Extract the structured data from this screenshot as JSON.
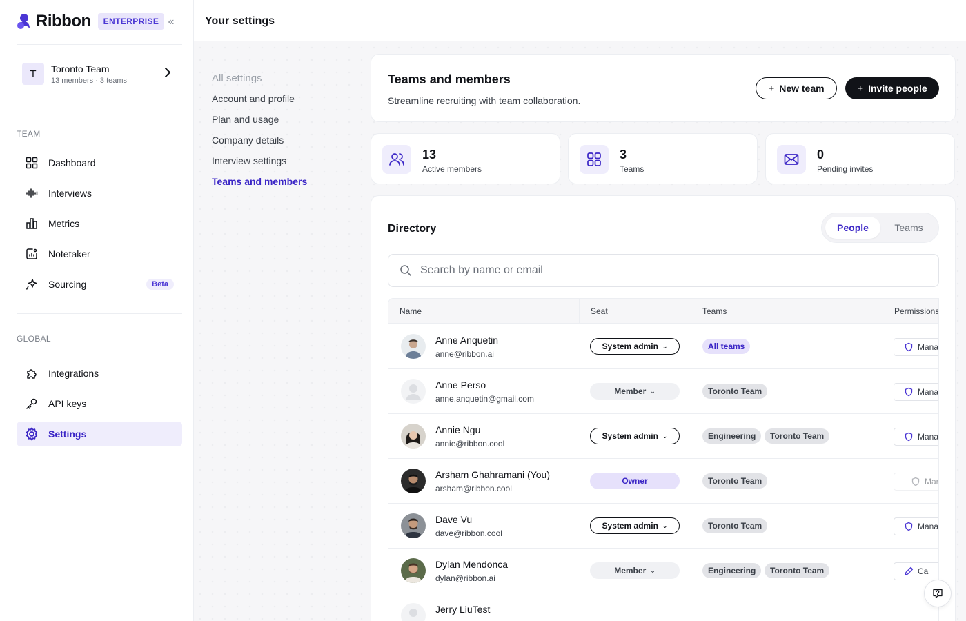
{
  "brand": {
    "name": "Ribbon",
    "badge": "ENTERPRISE",
    "accent": "#3b26c6"
  },
  "team_switcher": {
    "avatar_letter": "T",
    "name": "Toronto Team",
    "meta": "13 members · 3 teams"
  },
  "sidebar": {
    "team_section": "TEAM",
    "team_items": [
      {
        "label": "Dashboard",
        "icon": "grid-icon"
      },
      {
        "label": "Interviews",
        "icon": "waveform-icon"
      },
      {
        "label": "Metrics",
        "icon": "bar-chart-icon"
      },
      {
        "label": "Notetaker",
        "icon": "notetaker-icon"
      },
      {
        "label": "Sourcing",
        "icon": "sparkle-icon",
        "badge": "Beta"
      }
    ],
    "global_section": "GLOBAL",
    "global_items": [
      {
        "label": "Integrations",
        "icon": "puzzle-icon"
      },
      {
        "label": "API keys",
        "icon": "key-icon"
      },
      {
        "label": "Settings",
        "icon": "gear-icon",
        "active": true
      }
    ]
  },
  "topbar": {
    "title": "Your settings"
  },
  "settings_nav": {
    "heading": "All settings",
    "links": [
      "Account and profile",
      "Plan and usage",
      "Company details",
      "Interview settings",
      "Teams and members"
    ],
    "active": "Teams and members"
  },
  "header": {
    "title": "Teams and members",
    "subtitle": "Streamline recruiting with team collaboration.",
    "new_team": "New team",
    "invite": "Invite people"
  },
  "stats": [
    {
      "value": "13",
      "label": "Active members",
      "icon": "users-icon"
    },
    {
      "value": "3",
      "label": "Teams",
      "icon": "grid-icon"
    },
    {
      "value": "0",
      "label": "Pending invites",
      "icon": "mail-icon"
    }
  ],
  "directory": {
    "title": "Directory",
    "tabs": [
      "People",
      "Teams"
    ],
    "active_tab": "People",
    "search_placeholder": "Search by name or email",
    "columns": [
      "Name",
      "Seat",
      "Teams",
      "Permissions"
    ],
    "rows": [
      {
        "name": "Anne Anquetin",
        "email": "anne@ribbon.ai",
        "seat": "System admin",
        "seat_type": "admin",
        "teams": [
          "All teams"
        ],
        "perm": "Mana"
      },
      {
        "name": "Anne Perso",
        "email": "anne.anquetin@gmail.com",
        "seat": "Member",
        "seat_type": "member",
        "teams": [
          "Toronto Team"
        ],
        "perm": "Mana"
      },
      {
        "name": "Annie Ngu",
        "email": "annie@ribbon.cool",
        "seat": "System admin",
        "seat_type": "admin",
        "teams": [
          "Engineering",
          "Toronto Team"
        ],
        "perm": "Mana"
      },
      {
        "name": "Arsham Ghahramani (You)",
        "email": "arsham@ribbon.cool",
        "seat": "Owner",
        "seat_type": "owner",
        "teams": [
          "Toronto Team"
        ],
        "perm": "Mar"
      },
      {
        "name": "Dave Vu",
        "email": "dave@ribbon.cool",
        "seat": "System admin",
        "seat_type": "admin",
        "teams": [
          "Toronto Team"
        ],
        "perm": "Mana"
      },
      {
        "name": "Dylan Mendonca",
        "email": "dylan@ribbon.ai",
        "seat": "Member",
        "seat_type": "member",
        "teams": [
          "Engineering",
          "Toronto Team"
        ],
        "perm": "Ca"
      },
      {
        "name": "Jerry LiuTest",
        "email": "",
        "seat": "",
        "seat_type": "member",
        "teams": [],
        "perm": ""
      }
    ]
  }
}
